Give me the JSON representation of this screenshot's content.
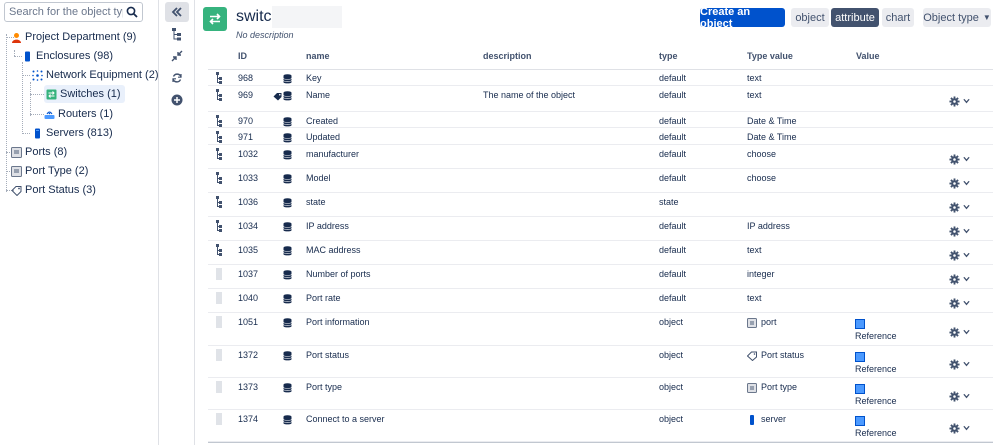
{
  "search": {
    "placeholder": "Search for the object type"
  },
  "tree": [
    {
      "label": "Project Department (9)",
      "icon": "person-icon",
      "color": "#ff8b00"
    },
    {
      "label": "Enclosures (98)",
      "icon": "rack-icon",
      "color": "#0052cc"
    },
    {
      "label": "Network Equipment (2)",
      "icon": "network-icon",
      "color": "#0052cc"
    },
    {
      "label": "Switches (1)",
      "icon": "switch-icon",
      "color": "#36b37e"
    },
    {
      "label": "Routers (1)",
      "icon": "router-icon",
      "color": "#0052cc"
    },
    {
      "label": "Servers (813)",
      "icon": "server-icon",
      "color": "#0052cc"
    },
    {
      "label": "Ports (8)",
      "icon": "port-icon",
      "color": "#6b778c"
    },
    {
      "label": "Port Type (2)",
      "icon": "port-icon",
      "color": "#6b778c"
    },
    {
      "label": "Port Status (3)",
      "icon": "tag-icon",
      "color": "#6b778c"
    }
  ],
  "header": {
    "title": "switch",
    "description": "No description",
    "create_button": "Create an object",
    "view_tabs": [
      "object",
      "attribute",
      "chart"
    ],
    "active_tab": "attribute",
    "object_type_dropdown": "Object type"
  },
  "table": {
    "columns": [
      "ID",
      "name",
      "description",
      "type",
      "Type value",
      "Value"
    ],
    "rows": [
      {
        "id": "968",
        "name": "Key",
        "description": "",
        "type": "default",
        "type_value": "text",
        "value": "",
        "handle": "tree",
        "gear": false,
        "tag": false,
        "tv_icon": ""
      },
      {
        "id": "969",
        "name": "Name",
        "description": "The name of the object",
        "type": "default",
        "type_value": "text",
        "value": "",
        "handle": "tree",
        "gear": true,
        "tag": true,
        "tv_icon": ""
      },
      {
        "id": "970",
        "name": "Created",
        "description": "",
        "type": "default",
        "type_value": "Date & Time",
        "value": "",
        "handle": "tree",
        "gear": false,
        "tag": false,
        "tv_icon": ""
      },
      {
        "id": "971",
        "name": "Updated",
        "description": "",
        "type": "default",
        "type_value": "Date & Time",
        "value": "",
        "handle": "tree",
        "gear": false,
        "tag": false,
        "tv_icon": ""
      },
      {
        "id": "1032",
        "name": "manufacturer",
        "description": "",
        "type": "default",
        "type_value": "choose",
        "value": "",
        "handle": "tree",
        "gear": true,
        "tag": false,
        "tv_icon": ""
      },
      {
        "id": "1033",
        "name": "Model",
        "description": "",
        "type": "default",
        "type_value": "choose",
        "value": "",
        "handle": "tree",
        "gear": true,
        "tag": false,
        "tv_icon": ""
      },
      {
        "id": "1036",
        "name": "state",
        "description": "",
        "type": "state",
        "type_value": "",
        "value": "",
        "handle": "tree",
        "gear": true,
        "tag": false,
        "tv_icon": ""
      },
      {
        "id": "1034",
        "name": "IP address",
        "description": "",
        "type": "default",
        "type_value": "IP address",
        "value": "",
        "handle": "tree",
        "gear": true,
        "tag": false,
        "tv_icon": ""
      },
      {
        "id": "1035",
        "name": "MAC address",
        "description": "",
        "type": "default",
        "type_value": "text",
        "value": "",
        "handle": "tree",
        "gear": true,
        "tag": false,
        "tv_icon": ""
      },
      {
        "id": "1037",
        "name": "Number of ports",
        "description": "",
        "type": "default",
        "type_value": "integer",
        "value": "",
        "handle": "drag",
        "gear": true,
        "tag": false,
        "tv_icon": ""
      },
      {
        "id": "1040",
        "name": "Port rate",
        "description": "",
        "type": "default",
        "type_value": "text",
        "value": "",
        "handle": "drag",
        "gear": true,
        "tag": false,
        "tv_icon": ""
      },
      {
        "id": "1051",
        "name": "Port information",
        "description": "",
        "type": "object",
        "type_value": "port",
        "value": "Reference",
        "handle": "drag",
        "gear": true,
        "tag": false,
        "tv_icon": "port-icon"
      },
      {
        "id": "1372",
        "name": "Port status",
        "description": "",
        "type": "object",
        "type_value": "Port status",
        "value": "Reference",
        "handle": "drag",
        "gear": true,
        "tag": false,
        "tv_icon": "tag-icon"
      },
      {
        "id": "1373",
        "name": "Port type",
        "description": "",
        "type": "object",
        "type_value": "Port type",
        "value": "Reference",
        "handle": "drag",
        "gear": true,
        "tag": false,
        "tv_icon": "port-icon"
      },
      {
        "id": "1374",
        "name": "Connect to a server",
        "description": "",
        "type": "object",
        "type_value": "server",
        "value": "Reference",
        "handle": "drag",
        "gear": true,
        "tag": false,
        "tv_icon": "server-icon"
      }
    ]
  },
  "colors": {
    "primary": "#0052cc",
    "green": "#36b37e",
    "reference": "#4c9aff"
  }
}
